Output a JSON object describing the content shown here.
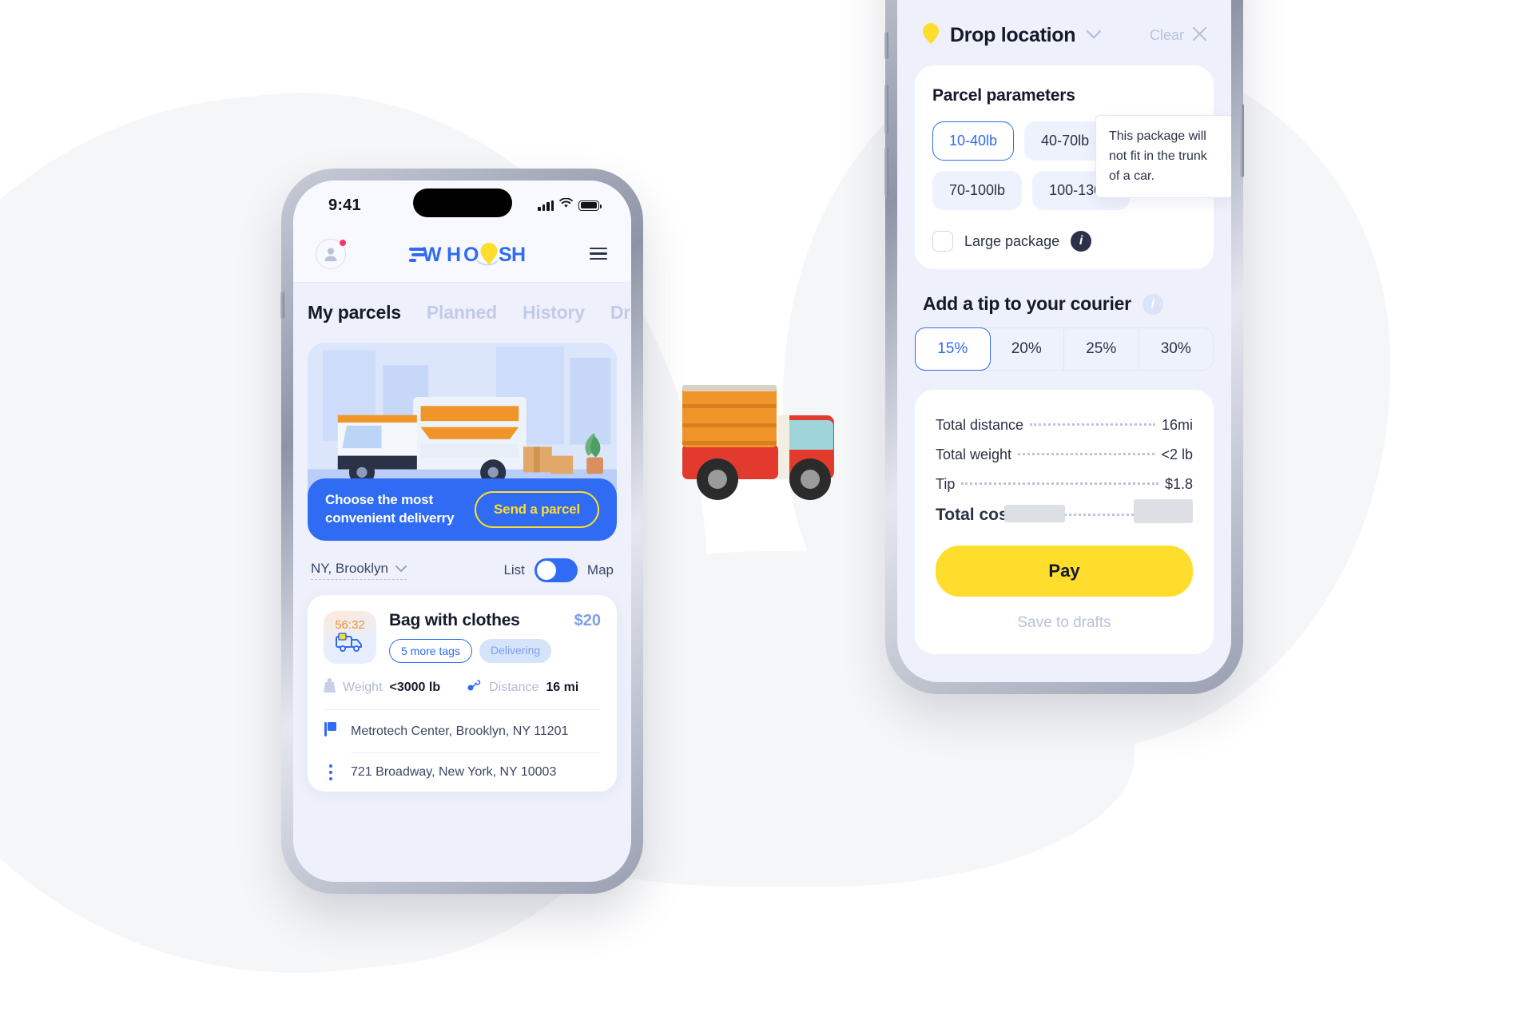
{
  "left_phone": {
    "status_bar": {
      "time": "9:41",
      "signal_icon": "signal-bars-icon",
      "wifi_icon": "wifi-icon",
      "battery_icon": "battery-icon"
    },
    "header": {
      "avatar_icon": "avatar-icon",
      "notification_dot": "notification-dot",
      "logo_text": "WHOOSH",
      "menu_icon": "hamburger-menu-icon"
    },
    "tabs": [
      {
        "label": "My parcels",
        "active": true
      },
      {
        "label": "Planned",
        "active": false
      },
      {
        "label": "History",
        "active": false
      },
      {
        "label": "Dr",
        "active": false
      }
    ],
    "banner": {
      "text_line1": "Choose the most",
      "text_line2": "convenient deliverry",
      "button_label": "Send a parcel",
      "bg_color": "#2f6bf3",
      "accent_color": "#ffdd2d"
    },
    "filters": {
      "location_label": "NY, Brooklyn",
      "chevron_icon": "chevron-down-icon",
      "view_list_label": "List",
      "view_map_label": "Map",
      "toggle_state": "List"
    },
    "parcel_card": {
      "timer": "56:32",
      "thumb_icon": "delivery-truck-icon",
      "title": "Bag with clothes",
      "price": "$20",
      "tags": [
        {
          "label": "5 more tags",
          "style": "outline"
        },
        {
          "label": "Delivering",
          "style": "filled"
        }
      ],
      "weight_icon": "weight-icon",
      "weight_label": "Weight",
      "weight_value": "<3000 lb",
      "distance_icon": "route-pin-icon",
      "distance_label": "Distance",
      "distance_value": "16 mi",
      "pickup_icon": "flag-icon",
      "pickup_address": "Metrotech Center, Brooklyn, NY 11201",
      "dropoff_icon": "location-dot-icon",
      "dropoff_address": "721 Broadway, New York, NY 10003"
    }
  },
  "right_phone": {
    "header": {
      "pin_icon": "map-pin-icon",
      "title": "Drop location",
      "chevron_icon": "chevron-down-icon",
      "clear_label": "Clear",
      "close_icon": "close-x-icon"
    },
    "parcel_parameters": {
      "title": "Parcel parameters",
      "weight_options": [
        {
          "label": "10-40lb",
          "selected": true
        },
        {
          "label": "40-70lb",
          "selected": false
        },
        {
          "label": "70-100lb",
          "selected": false
        },
        {
          "label": "100-130lb",
          "selected": false
        }
      ],
      "large_package_label": "Large package",
      "large_package_checked": false,
      "info_icon": "info-icon",
      "tooltip_text": "This package will not fit in the trunk of a car."
    },
    "tip": {
      "title": "Add a tip to your courier",
      "info_icon": "info-icon",
      "options": [
        {
          "label": "15%",
          "selected": true
        },
        {
          "label": "20%",
          "selected": false
        },
        {
          "label": "25%",
          "selected": false
        },
        {
          "label": "30%",
          "selected": false
        }
      ]
    },
    "summary": {
      "rows": [
        {
          "label": "Total distance",
          "value": "16mi"
        },
        {
          "label": "Total weight",
          "value": "<2 lb"
        },
        {
          "label": "Tip",
          "value": "$1.8"
        }
      ],
      "total_label": "Total cost",
      "total_value_redacted": true,
      "pay_label": "Pay",
      "drafts_label": "Save to drafts",
      "pay_color": "#ffdd2d"
    }
  },
  "decorations": {
    "truck_emoji_icon": "delivery-truck-emoji"
  }
}
